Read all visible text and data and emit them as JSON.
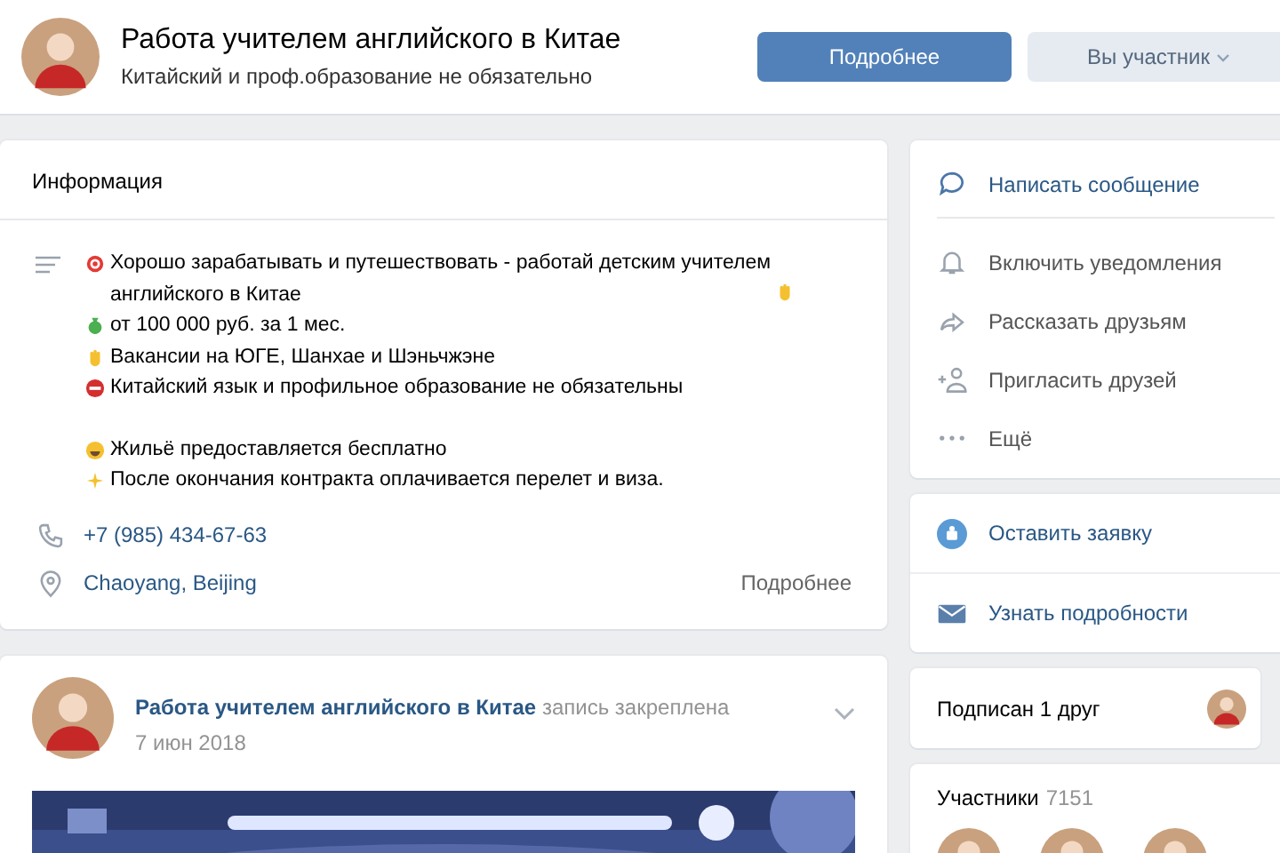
{
  "header": {
    "title": "Работа учителем английского в Китае",
    "subtitle": "Китайский и проф.образование не обязательно",
    "primary_button": "Подробнее",
    "member_button": "Вы участник"
  },
  "info": {
    "title": "Информация",
    "paragraphs": [
      {
        "lines": [
          "Хорошо зарабатывать и путешествовать - работай детским учителем английского в Китае",
          "от 100 000 руб. за 1 мес.",
          "Вакансии на ЮГЕ, Шанхае и Шэньчжэне",
          "Китайский язык и профильное образование не обязательны"
        ]
      },
      {
        "lines": [
          "Жильё предоставляется бесплатно",
          "После окончания контракта оплачивается перелет и виза."
        ]
      }
    ],
    "contacts": [
      "+7 (985) 434-67-63",
      "Chaoyang, Beijing"
    ],
    "more_link": "Подробнее"
  },
  "post": {
    "author": "Работа учителем английского в Китае",
    "note": "запись закреплена",
    "date": "7 июн 2018"
  },
  "actions": [
    {
      "label": "Написать сообщение",
      "accent": true
    },
    {
      "label": "Включить уведомления",
      "accent": false
    },
    {
      "label": "Рассказать друзьям",
      "accent": false
    },
    {
      "label": "Пригласить друзей",
      "accent": false
    },
    {
      "label": "Ещё",
      "accent": false
    }
  ],
  "apps": [
    "Оставить заявку",
    "Узнать подробности"
  ],
  "friends": {
    "label": "Подписан 1 друг"
  },
  "members": {
    "title": "Участники",
    "count": "7151"
  }
}
